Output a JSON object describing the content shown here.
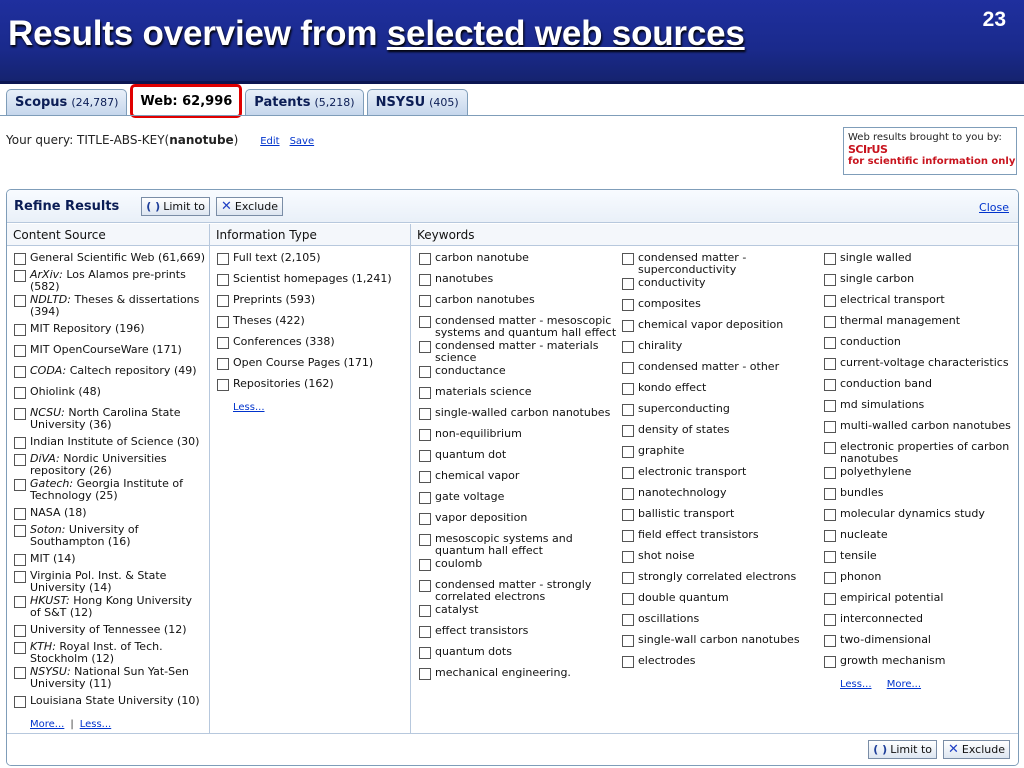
{
  "slide": {
    "title_prefix": "Results overview from ",
    "title_underlined": "selected web sources",
    "page_number": "23"
  },
  "tabs": [
    {
      "label": "Scopus",
      "count": "(24,787)",
      "active": false
    },
    {
      "label": "Web: 62,996",
      "count": "",
      "active": true
    },
    {
      "label": "Patents",
      "count": "(5,218)",
      "active": false
    },
    {
      "label": "NSYSU",
      "count": "(405)",
      "active": false
    }
  ],
  "query": {
    "prefix": "Your query: TITLE-ABS-KEY(",
    "term": "nanotube",
    "suffix": ")",
    "edit_label": "Edit",
    "save_label": "Save"
  },
  "scirus": {
    "line1": "Web results brought to you by:",
    "logo": "SCIrUS",
    "line2": "for scientific information only"
  },
  "refine": {
    "title": "Refine Results",
    "limit_label": "Limit to",
    "exclude_label": "Exclude",
    "close_label": "Close",
    "columns": {
      "content_source": "Content Source",
      "information_type": "Information Type",
      "keywords": "Keywords"
    },
    "content_sources": [
      {
        "prefix": "",
        "text": "General Scientific Web (61,669)"
      },
      {
        "prefix": "ArXiv:",
        "text": " Los Alamos pre-prints (582)"
      },
      {
        "prefix": "NDLTD:",
        "text": " Theses & dissertations (394)"
      },
      {
        "prefix": "",
        "text": "MIT Repository (196)"
      },
      {
        "prefix": "",
        "text": "MIT OpenCourseWare (171)"
      },
      {
        "prefix": "CODA:",
        "text": " Caltech repository (49)"
      },
      {
        "prefix": "",
        "text": "Ohiolink (48)"
      },
      {
        "prefix": "NCSU:",
        "text": " North Carolina State University (36)"
      },
      {
        "prefix": "",
        "text": "Indian Institute of Science (30)"
      },
      {
        "prefix": "DiVA:",
        "text": " Nordic Universities repository (26)"
      },
      {
        "prefix": "Gatech:",
        "text": " Georgia Institute of Technology (25)"
      },
      {
        "prefix": "",
        "text": "NASA (18)"
      },
      {
        "prefix": "Soton:",
        "text": " University of Southampton (16)"
      },
      {
        "prefix": "",
        "text": "MIT (14)"
      },
      {
        "prefix": "",
        "text": "Virginia Pol. Inst. & State University (14)"
      },
      {
        "prefix": "HKUST:",
        "text": " Hong Kong University of S&T (12)"
      },
      {
        "prefix": "",
        "text": "University of Tennessee (12)"
      },
      {
        "prefix": "KTH:",
        "text": " Royal Inst. of Tech. Stockholm (12)"
      },
      {
        "prefix": "NSYSU:",
        "text": " National Sun Yat-Sen University (11)"
      },
      {
        "prefix": "",
        "text": "Louisiana State University (10)"
      }
    ],
    "content_links": {
      "more": "More...",
      "separator": "|",
      "less": "Less..."
    },
    "information_types": [
      "Full text (2,105)",
      "Scientist homepages (1,241)",
      "Preprints (593)",
      "Theses (422)",
      "Conferences (338)",
      "Open Course Pages (171)",
      "Repositories (162)"
    ],
    "info_links": {
      "less": "Less..."
    },
    "keywords_col1": [
      "carbon nanotube",
      "nanotubes",
      "carbon nanotubes",
      "condensed matter - mesoscopic systems and quantum hall effect",
      "condensed matter - materials science",
      "conductance",
      "materials science",
      "single-walled carbon nanotubes",
      "non-equilibrium",
      "quantum dot",
      "chemical vapor",
      "gate voltage",
      "vapor deposition",
      "mesoscopic systems and quantum hall effect",
      "coulomb",
      "condensed matter - strongly correlated electrons",
      "catalyst",
      "effect transistors",
      "quantum dots",
      "mechanical engineering."
    ],
    "keywords_col2": [
      "condensed matter - superconductivity",
      "conductivity",
      "composites",
      "chemical vapor deposition",
      "chirality",
      "condensed matter - other",
      "kondo effect",
      "superconducting",
      "density of states",
      "graphite",
      "electronic transport",
      "nanotechnology",
      "ballistic transport",
      "field effect transistors",
      "shot noise",
      "strongly correlated electrons",
      "double quantum",
      "oscillations",
      "single-wall carbon nanotubes",
      "electrodes"
    ],
    "keywords_col3": [
      "single walled",
      "single carbon",
      "electrical transport",
      "thermal management",
      "conduction",
      "current-voltage characteristics",
      "conduction band",
      "md simulations",
      "multi-walled carbon nanotubes",
      "electronic properties of carbon nanotubes",
      "polyethylene",
      "bundles",
      "molecular dynamics study",
      "nucleate",
      "tensile",
      "phonon",
      "empirical potential",
      "interconnected",
      "two-dimensional",
      "growth mechanism"
    ],
    "keyword_links": {
      "less": "Less...",
      "more": "More..."
    },
    "icons": {
      "limit": "parentheses-icon",
      "exclude": "x-icon"
    }
  }
}
